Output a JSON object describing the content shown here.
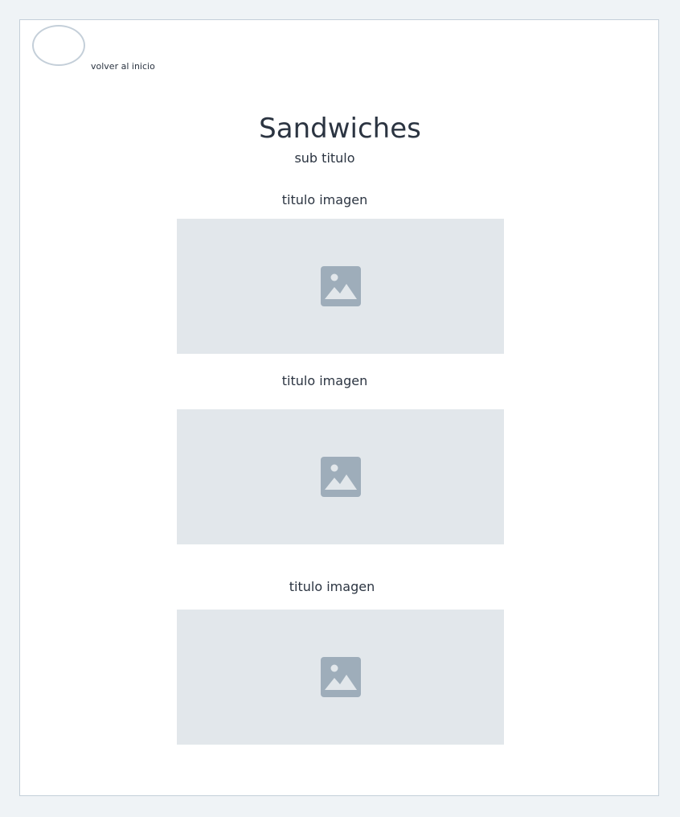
{
  "header": {
    "logo_icon": "logo-placeholder-ellipse",
    "back_link": "volver al inicio"
  },
  "page": {
    "title": "Sandwiches",
    "subtitle": "sub titulo"
  },
  "gallery": [
    {
      "title": "titulo imagen",
      "icon": "image-placeholder-icon"
    },
    {
      "title": "titulo imagen",
      "icon": "image-placeholder-icon"
    },
    {
      "title": "titulo imagen",
      "icon": "image-placeholder-icon"
    }
  ],
  "colors": {
    "background": "#eff3f6",
    "frame": "#ffffff",
    "border": "#c4cfd9",
    "placeholder": "#e2e7eb",
    "icon": "#9eadba",
    "text": "#2b3441"
  }
}
